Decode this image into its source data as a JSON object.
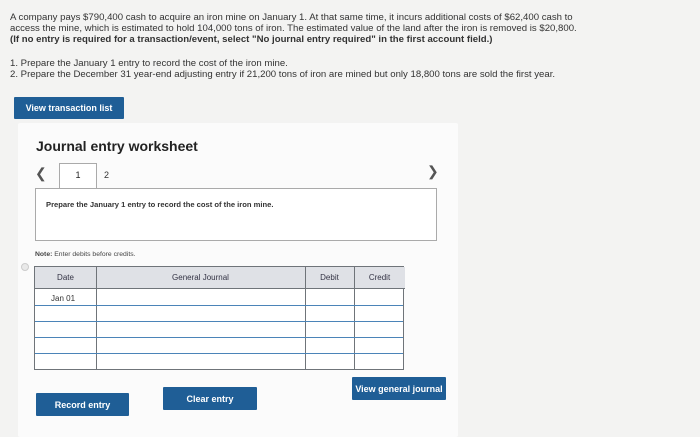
{
  "problem": {
    "line1": "A company pays $790,400 cash to acquire an iron mine on January 1. At that same time, it incurs additional costs of $62,400 cash to",
    "line2": "access the mine, which is estimated to hold 104,000 tons of iron. The estimated value of the land after the iron is removed is $20,800.",
    "note": "(If no entry is required for a transaction/event, select \"No journal entry required\" in the first account field.)"
  },
  "requirements": {
    "req1": "1. Prepare the January 1 entry to record the cost of the iron mine.",
    "req2": "2. Prepare the December 31 year-end adjusting entry if 21,200 tons of iron are mined but only 18,800 tons are sold the first year."
  },
  "buttons": {
    "view_transaction_list": "View transaction list",
    "record_entry": "Record entry",
    "clear_entry": "Clear entry",
    "view_general_journal": "View general journal"
  },
  "worksheet": {
    "title": "Journal entry worksheet",
    "tabs": [
      "1",
      "2"
    ],
    "instruction": "Prepare the January 1 entry to record the cost of the iron mine.",
    "note_prefix": "Note:",
    "note_text": " Enter debits before credits."
  },
  "journal": {
    "headers": {
      "date": "Date",
      "account": "General Journal",
      "debit": "Debit",
      "credit": "Credit"
    },
    "first_date": "Jan 01"
  },
  "colors": {
    "button_blue": "#1f5e96",
    "header_gray": "#dfe1e6",
    "row_line_blue": "#4b84b8"
  }
}
